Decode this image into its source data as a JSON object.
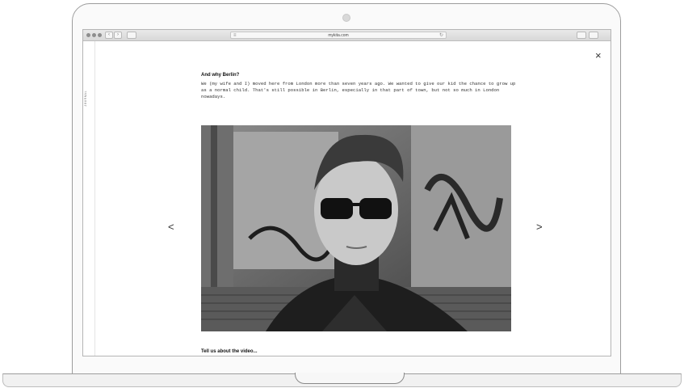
{
  "browser": {
    "url": "mykita.com"
  },
  "sidebar": {
    "label": "JOURNAL"
  },
  "article": {
    "heading": "And why Berlin?",
    "paragraph": "We (my wife and I) moved here from London more than seven years ago. We wanted to give our kid the chance to grow up as a normal child. That's still possible in Berlin, especially in that part of town, but not so much in London nowadays.",
    "next_heading": "Tell us about the video..."
  },
  "controls": {
    "close": "×",
    "prev": "<",
    "next": ">"
  }
}
